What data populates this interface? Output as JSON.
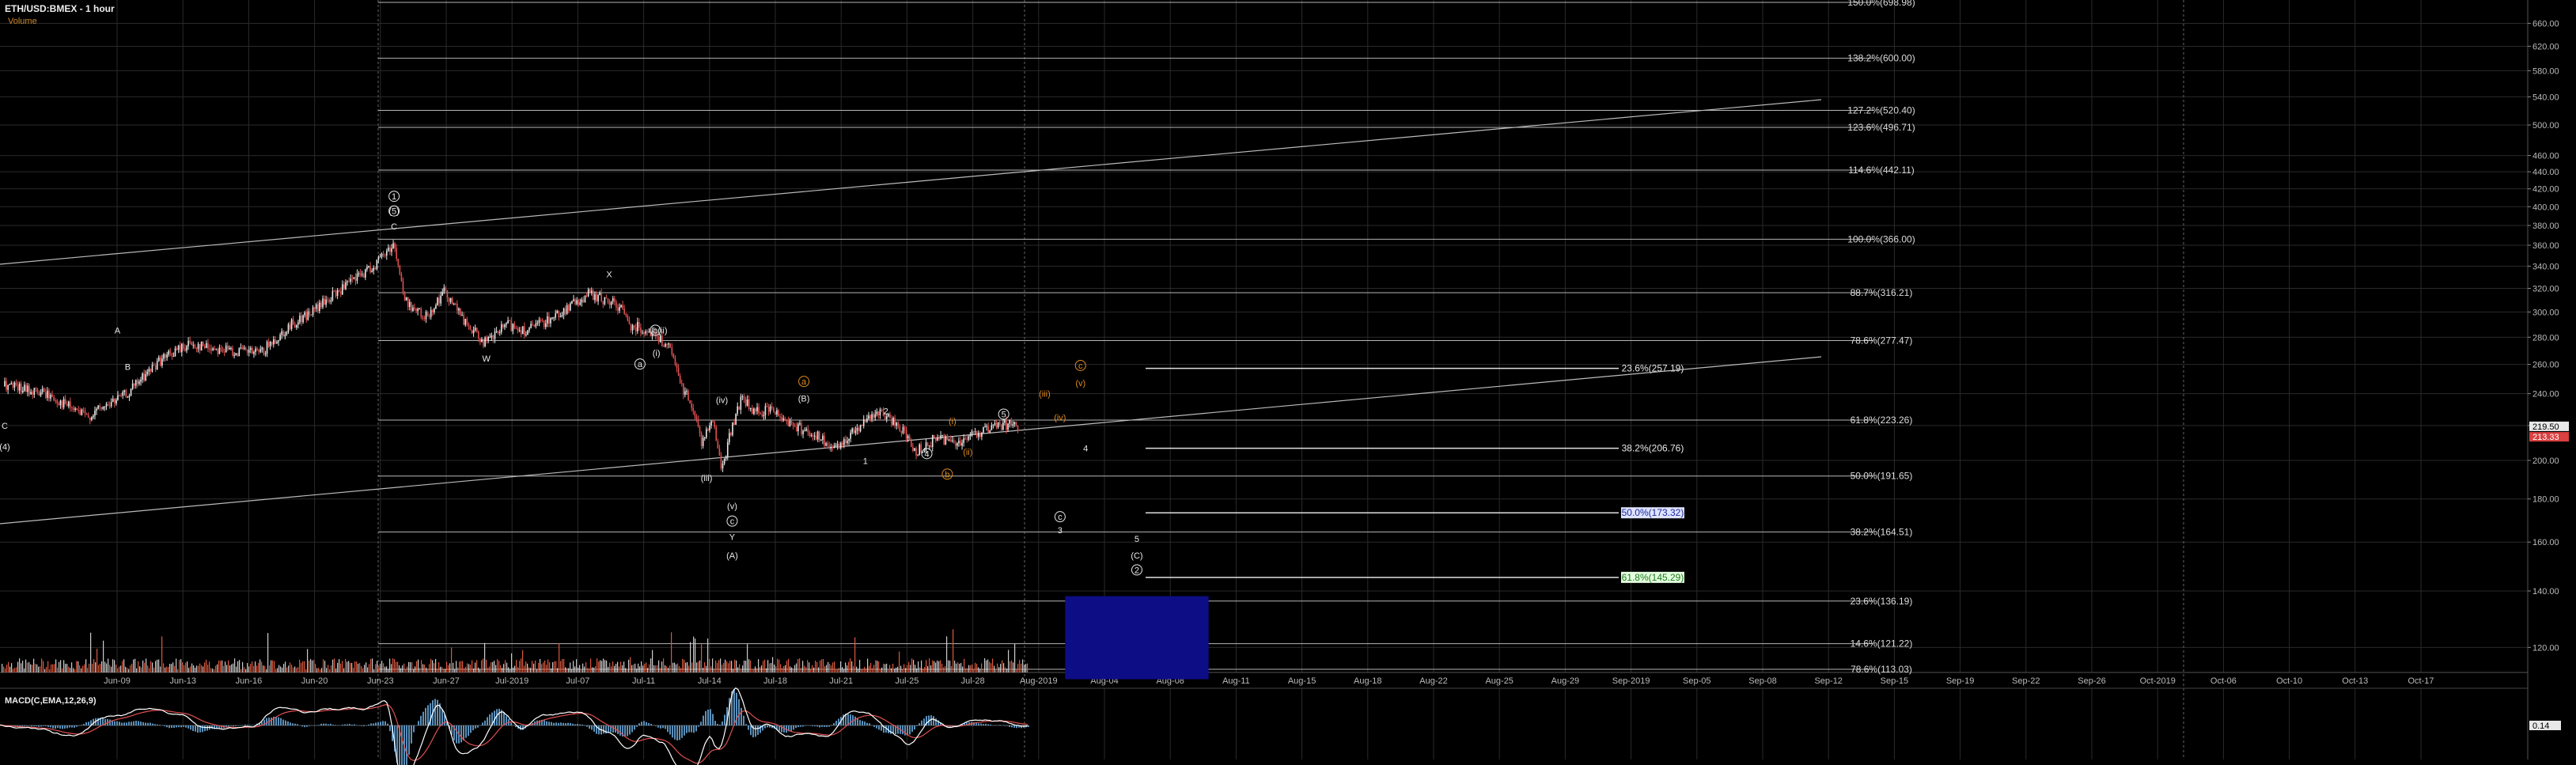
{
  "header": {
    "title": "ETH/USD:BMEX - 1 hour",
    "volume_label": "Volume"
  },
  "macd": {
    "title": "MACD(C,EMA,12,26,9)",
    "last_value": "0.14"
  },
  "colors": {
    "background": "#000000",
    "grid": "#2a2a2a",
    "axis_text": "#bbbbbb",
    "candle_up": "#e8e8e8",
    "candle_down": "#e05050",
    "fib_line": "#b5b5b5",
    "label_orange": "#e08a1e",
    "target_box": "#0d0d86",
    "macd": "#ffffff",
    "signal": "#e05050",
    "histogram": "#5b8fb9"
  },
  "chart_data": [
    {
      "type": "line",
      "name": "ETH/USD:BMEX - 1 hour",
      "ylim": [
        108,
        700
      ],
      "y_scale": "log",
      "yticks": [
        120,
        140,
        160,
        180,
        200,
        220,
        240,
        260,
        280,
        300,
        320,
        340,
        360,
        380,
        400,
        420,
        440,
        460,
        500,
        540,
        580,
        620,
        660
      ],
      "xlabels": [
        "Jun-09",
        "Jun-13",
        "Jun-16",
        "Jun-20",
        "Jun-23",
        "Jun-27",
        "Jul-2019",
        "Jul-07",
        "Jul-11",
        "Jul-14",
        "Jul-18",
        "Jul-21",
        "Jul-25",
        "Jul-28",
        "Aug-2019",
        "Aug-04",
        "Aug-08",
        "Aug-11",
        "Aug-15",
        "Aug-18",
        "Aug-22",
        "Aug-25",
        "Aug-29",
        "Sep-2019",
        "Sep-05",
        "Sep-08",
        "Sep-12",
        "Sep-15",
        "Sep-19",
        "Sep-22",
        "Sep-26",
        "Oct-2019",
        "Oct-06",
        "Oct-10",
        "Oct-13",
        "Oct-17"
      ],
      "price_path": [
        [
          0,
          245
        ],
        [
          4,
          240
        ],
        [
          8,
          225
        ],
        [
          12,
          240
        ],
        [
          15,
          262
        ],
        [
          18,
          275
        ],
        [
          22,
          270
        ],
        [
          25,
          268
        ],
        [
          28,
          290
        ],
        [
          30,
          300
        ],
        [
          33,
          320
        ],
        [
          36,
          340
        ],
        [
          38,
          362
        ],
        [
          39,
          310
        ],
        [
          41,
          295
        ],
        [
          43,
          318
        ],
        [
          45,
          290
        ],
        [
          47,
          275
        ],
        [
          49,
          290
        ],
        [
          51,
          285
        ],
        [
          54,
          298
        ],
        [
          57,
          315
        ],
        [
          60,
          305
        ],
        [
          61,
          290
        ],
        [
          63,
          285
        ],
        [
          65,
          270
        ],
        [
          66,
          245
        ],
        [
          67,
          235
        ],
        [
          68,
          210
        ],
        [
          69,
          225
        ],
        [
          70,
          195
        ],
        [
          71,
          220
        ],
        [
          72,
          238
        ],
        [
          73,
          228
        ],
        [
          75,
          230
        ],
        [
          77,
          220
        ],
        [
          79,
          215
        ],
        [
          81,
          205
        ],
        [
          83,
          218
        ],
        [
          85,
          228
        ],
        [
          87,
          222
        ],
        [
          89,
          205
        ],
        [
          91,
          213
        ],
        [
          93,
          210
        ],
        [
          95,
          216
        ],
        [
          98,
          221
        ],
        [
          99,
          219.5
        ]
      ],
      "last_prices": [
        "219.50",
        "213.33"
      ],
      "fib_levels": [
        {
          "label": "150.0%(698.98)",
          "value": 698.98
        },
        {
          "label": "138.2%(600.00)",
          "value": 600.0
        },
        {
          "label": "127.2%(520.40)",
          "value": 520.4
        },
        {
          "label": "123.6%(496.71)",
          "value": 496.71
        },
        {
          "label": "114.6%(442.11)",
          "value": 442.11
        },
        {
          "label": "100.0%(366.00)",
          "value": 366.0
        },
        {
          "label": "88.7%(316.21)",
          "value": 316.21
        },
        {
          "label": "78.6%(277.47)",
          "value": 277.47
        },
        {
          "label": "61.8%(223.26)",
          "value": 223.26
        },
        {
          "label": "50.0%(191.65)",
          "value": 191.65
        },
        {
          "label": "38.2%(164.51)",
          "value": 164.51
        },
        {
          "label": "23.6%(136.19)",
          "value": 136.19
        },
        {
          "label": "14.6%(121.22)",
          "value": 121.22
        },
        {
          "label": "78.6%(113.03)",
          "value": 113.03
        }
      ],
      "fib_levels_right": [
        {
          "label": "23.6%(257.19)",
          "value": 257.19,
          "style": "plain"
        },
        {
          "label": "38.2%(206.76)",
          "value": 206.76,
          "style": "plain"
        },
        {
          "label": "50.0%(173.32)",
          "value": 173.32,
          "style": "blue"
        },
        {
          "label": "61.8%(145.29)",
          "value": 145.29,
          "style": "green"
        }
      ],
      "wave_labels": [
        {
          "t": 0,
          "price": 218,
          "text": "C",
          "color": "w"
        },
        {
          "t": 0,
          "price": 206,
          "text": "(4)",
          "color": "w"
        },
        {
          "t": 11,
          "price": 283,
          "text": "A",
          "color": "w"
        },
        {
          "t": 12,
          "price": 256,
          "text": "B",
          "color": "w"
        },
        {
          "t": 38,
          "price": 408,
          "text": "1",
          "color": "w",
          "circle": true
        },
        {
          "t": 38,
          "price": 392,
          "text": "(5)",
          "color": "w",
          "circle": true
        },
        {
          "t": 38,
          "price": 376,
          "text": "C",
          "color": "w"
        },
        {
          "t": 47,
          "price": 262,
          "text": "W",
          "color": "w"
        },
        {
          "t": 59,
          "price": 330,
          "text": "X",
          "color": "w"
        },
        {
          "t": 62,
          "price": 258,
          "text": "a",
          "color": "w",
          "circle": true
        },
        {
          "t": 63.5,
          "price": 283,
          "text": "b",
          "color": "w",
          "circle": true
        },
        {
          "t": 64.2,
          "price": 283,
          "text": "(ii)",
          "color": "w"
        },
        {
          "t": 63.6,
          "price": 266,
          "text": "(i)",
          "color": "w"
        },
        {
          "t": 70,
          "price": 234,
          "text": "(iv)",
          "color": "w"
        },
        {
          "t": 68.5,
          "price": 189,
          "text": "(iii)",
          "color": "w"
        },
        {
          "t": 71,
          "price": 175,
          "text": "(v)",
          "color": "w"
        },
        {
          "t": 71,
          "price": 168,
          "text": "c",
          "color": "w",
          "circle": true
        },
        {
          "t": 71,
          "price": 161,
          "text": "Y",
          "color": "w"
        },
        {
          "t": 71,
          "price": 153,
          "text": "(A)",
          "color": "w"
        },
        {
          "t": 78,
          "price": 246,
          "text": "a",
          "color": "o",
          "circle": true
        },
        {
          "t": 78,
          "price": 235,
          "text": "(B)",
          "color": "w"
        },
        {
          "t": 86,
          "price": 227,
          "text": "2",
          "color": "w"
        },
        {
          "t": 84,
          "price": 198,
          "text": "1",
          "color": "w"
        },
        {
          "t": 90,
          "price": 202,
          "text": "4",
          "color": "w",
          "circle": true
        },
        {
          "t": 92.5,
          "price": 221,
          "text": "(i)",
          "color": "o"
        },
        {
          "t": 94,
          "price": 203,
          "text": "(ii)",
          "color": "o"
        },
        {
          "t": 92,
          "price": 191,
          "text": "b",
          "color": "o",
          "circle": true
        },
        {
          "t": 97.5,
          "price": 225,
          "text": "5",
          "color": "w",
          "circle": true
        },
        {
          "t": 101.5,
          "price": 238,
          "text": "(iii)",
          "color": "o"
        },
        {
          "t": 103,
          "price": 223,
          "text": "(iv)",
          "color": "o"
        },
        {
          "t": 105,
          "price": 257,
          "text": "c",
          "color": "o",
          "circle": true
        },
        {
          "t": 105,
          "price": 245,
          "text": "(v)",
          "color": "o"
        },
        {
          "t": 105.5,
          "price": 205,
          "text": "4",
          "color": "w"
        },
        {
          "t": 103,
          "price": 170,
          "text": "c",
          "color": "w",
          "circle": true
        },
        {
          "t": 103,
          "price": 164,
          "text": "3",
          "color": "w"
        },
        {
          "t": 110.5,
          "price": 160,
          "text": "5",
          "color": "w"
        },
        {
          "t": 110.5,
          "price": 153,
          "text": "(C)",
          "color": "w"
        },
        {
          "t": 110.5,
          "price": 147,
          "text": "2",
          "color": "w",
          "circle": true
        }
      ],
      "target_box": {
        "t0": 103.5,
        "t1": 117.5,
        "p_low": 110,
        "p_high": 138
      }
    },
    {
      "type": "line",
      "name": "MACD(C,EMA,12,26,9)",
      "ylim": [
        -8,
        8
      ]
    }
  ]
}
